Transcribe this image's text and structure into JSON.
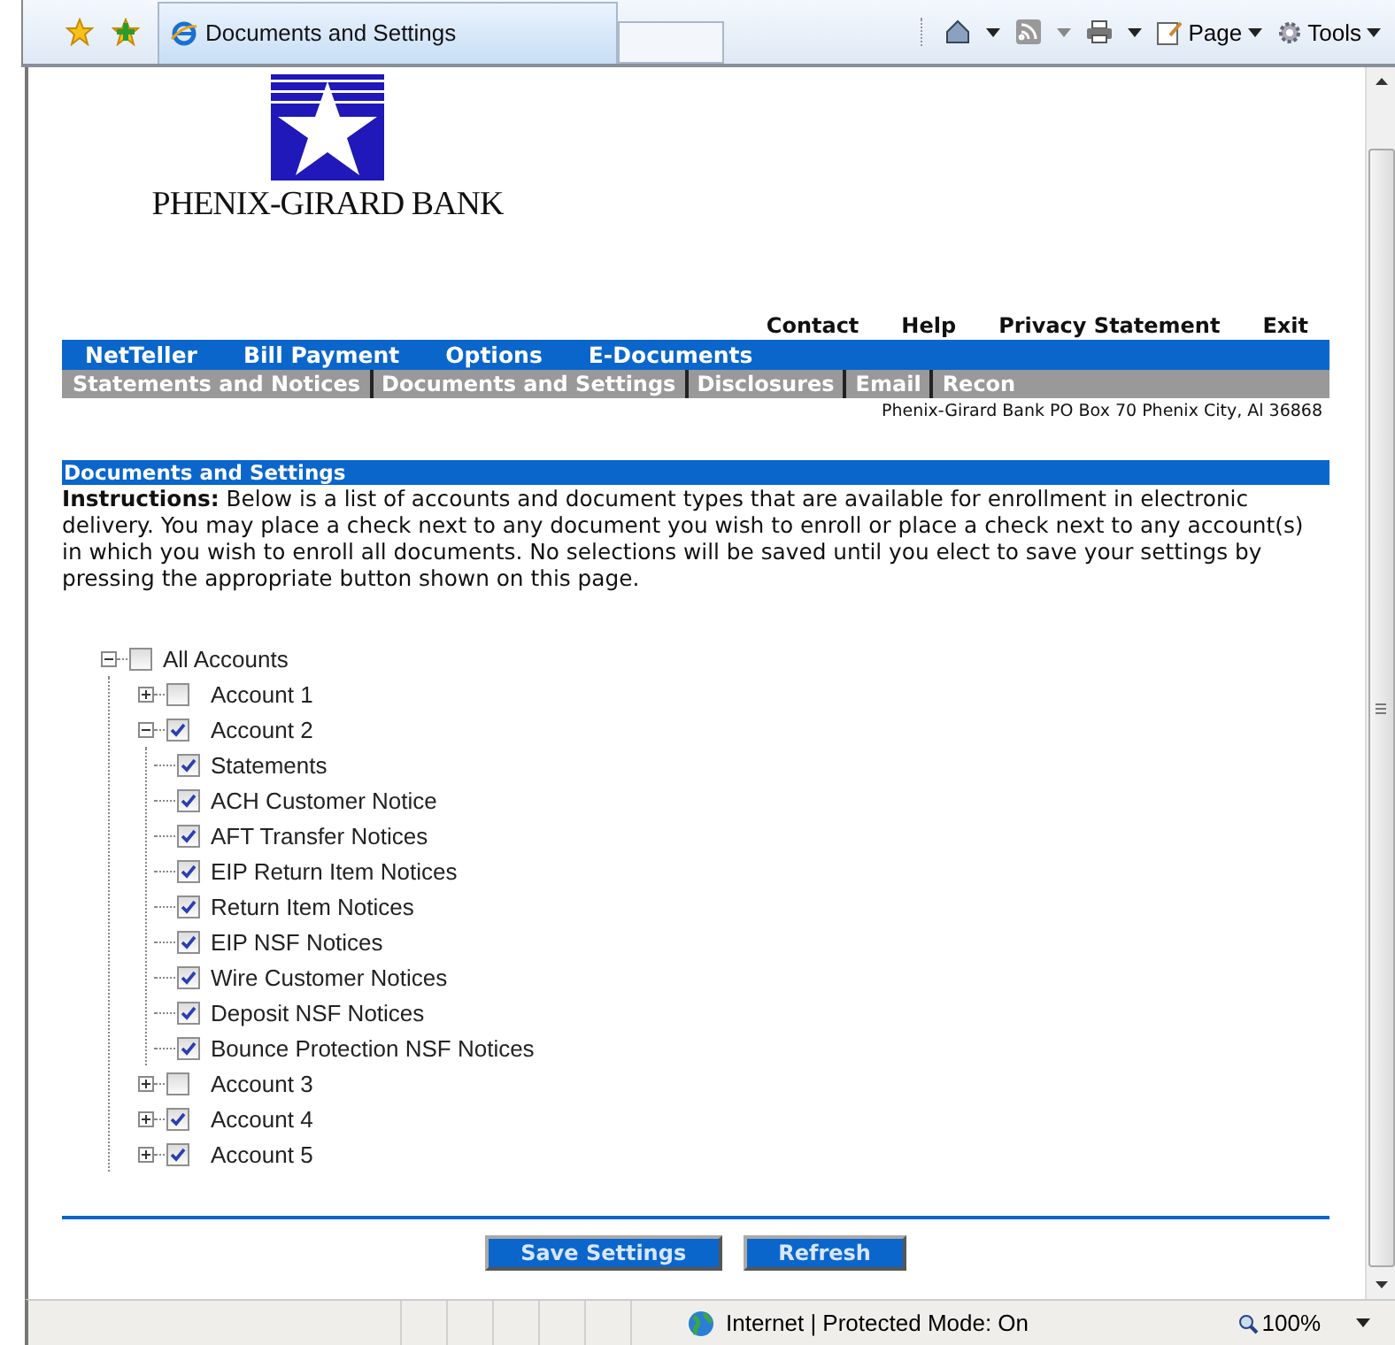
{
  "browser": {
    "tab_title": "Documents and Settings",
    "menu": [
      {
        "label": "Page"
      },
      {
        "label": "Tools"
      }
    ]
  },
  "logo": {
    "name": "PHENIX-GIRARD BANK"
  },
  "top_links": [
    "Contact",
    "Help",
    "Privacy Statement",
    "Exit"
  ],
  "main_nav": [
    "NetTeller",
    "Bill Payment",
    "Options",
    "E-Documents"
  ],
  "sub_nav": [
    "Statements and Notices",
    "Documents and Settings",
    "Disclosures",
    "Email",
    "Recon"
  ],
  "address": "Phenix-Girard Bank PO Box 70 Phenix City, Al 36868",
  "section": {
    "title": "Documents and Settings",
    "instructions": "**Instructions:** Below is a list of accounts and document types that are available for enrollment in electronic delivery. You may place a check next to any document you wish to enroll or place a check next to any account(s) in which you wish to enroll all documents. No selections will be saved until you elect to save your settings by pressing the appropriate button shown on this page."
  },
  "tree": {
    "label": "All Accounts",
    "checked": false,
    "expanded": true,
    "children": [
      {
        "label": "Account 1",
        "checked": false,
        "expanded": false
      },
      {
        "label": "Account 2",
        "checked": true,
        "expanded": true,
        "children": [
          {
            "label": "Statements",
            "checked": true
          },
          {
            "label": "ACH Customer Notice",
            "checked": true
          },
          {
            "label": "AFT Transfer Notices",
            "checked": true
          },
          {
            "label": "EIP Return Item Notices",
            "checked": true
          },
          {
            "label": "Return Item Notices",
            "checked": true
          },
          {
            "label": "EIP NSF Notices",
            "checked": true
          },
          {
            "label": "Wire Customer Notices",
            "checked": true
          },
          {
            "label": "Deposit NSF Notices",
            "checked": true
          },
          {
            "label": "Bounce Protection NSF Notices",
            "checked": true
          }
        ]
      },
      {
        "label": "Account 3",
        "checked": false,
        "expanded": false
      },
      {
        "label": "Account 4",
        "checked": true,
        "expanded": false
      },
      {
        "label": "Account 5",
        "checked": true,
        "expanded": false
      }
    ]
  },
  "buttons": [
    "Save Settings",
    "Refresh"
  ],
  "status_bar": {
    "zone": "Internet | Protected Mode: On",
    "zoom": "100%"
  }
}
